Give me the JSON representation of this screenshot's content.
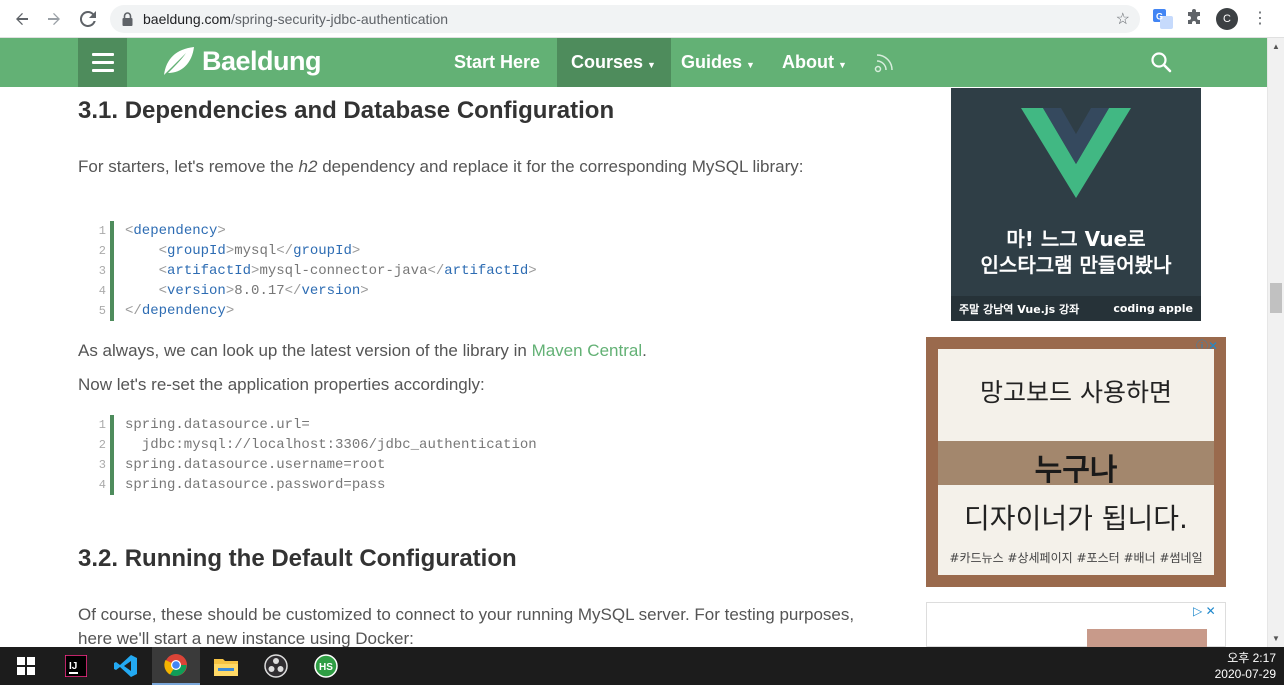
{
  "browser": {
    "url_domain": "baeldung.com",
    "url_path": "/spring-security-jdbc-authentication",
    "avatar_letter": "C"
  },
  "site": {
    "logo": "Baeldung",
    "nav": [
      {
        "label": "Start Here",
        "caret": ""
      },
      {
        "label": "Courses",
        "caret": "▼"
      },
      {
        "label": "Guides",
        "caret": "▼"
      },
      {
        "label": "About",
        "caret": "▼"
      }
    ],
    "accent": "#63b175",
    "accent_dark": "#4e8c5c"
  },
  "article": {
    "h_31": "3.1. Dependencies and Database Configuration",
    "p1_a": "For starters, let's remove the ",
    "p1_em": "h2",
    "p1_b": " dependency and replace it for the corresponding MySQL library:",
    "code1_lines": [
      "1",
      "2",
      "3",
      "4",
      "5"
    ],
    "code1": {
      "l1_tag": "dependency",
      "l2_tag": "groupId",
      "l2_val": "mysql",
      "l3_tag": "artifactId",
      "l3_val": "mysql-connector-java",
      "l4_tag": "version",
      "l4_val": "8.0.17",
      "l5_tag": "dependency"
    },
    "p2_a": "As always, we can look up the latest version of the library in ",
    "p2_link": "Maven Central",
    "p2_b": ".",
    "p3": "Now let's re-set the application properties accordingly:",
    "code2_lines": [
      "1",
      "2",
      "3",
      "4"
    ],
    "code2": [
      "spring.datasource.url=",
      "  jdbc:mysql://localhost:3306/jdbc_authentication",
      "spring.datasource.username=root",
      "spring.datasource.password=pass"
    ],
    "h_32": "3.2. Running the Default Configuration",
    "p4": "Of course, these should be customized to connect to your running MySQL server. For testing purposes, here we'll start a new instance using Docker:"
  },
  "ads": {
    "ad1_line1": "마! 느그 Vue로",
    "ad1_line2": "인스타그램 만들어봤나",
    "ad1_foot_left": "주말 강남역 Vue.js 강좌",
    "ad1_foot_right": "coding apple",
    "ad2_line1": "망고보드 사용하면",
    "ad2_line2": "누구나",
    "ad2_line3": "디자이너가 됩니다.",
    "ad2_tags": "#카드뉴스 #상세페이지 #포스터 #배너 #썸네일"
  },
  "taskbar": {
    "time": "오후 2:17",
    "date": "2020-07-29"
  }
}
